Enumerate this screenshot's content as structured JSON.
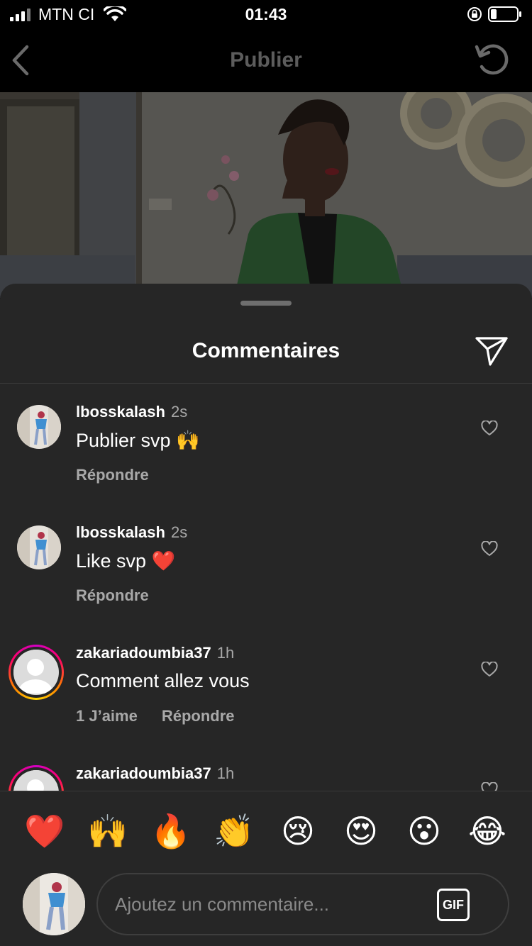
{
  "status_bar": {
    "carrier": "MTN CI",
    "time": "01:43"
  },
  "nav": {
    "title": "Publier"
  },
  "sheet": {
    "title": "Commentaires"
  },
  "comments": [
    {
      "username": "lbosskalash",
      "time": "2s",
      "text": "Publier svp 🙌",
      "likes": "",
      "reply": "Répondre",
      "has_story_ring": false
    },
    {
      "username": "lbosskalash",
      "time": "2s",
      "text": "Like svp ❤️",
      "likes": "",
      "reply": "Répondre",
      "has_story_ring": false
    },
    {
      "username": "zakariadoumbia37",
      "time": "1h",
      "text": "Comment allez vous",
      "likes": "1 J’aime",
      "reply": "Répondre",
      "has_story_ring": true
    },
    {
      "username": "zakariadoumbia37",
      "time": "1h",
      "text": "",
      "likes": "",
      "reply": "",
      "has_story_ring": true
    }
  ],
  "quick_reactions": [
    "❤️",
    "🙌",
    "🔥",
    "👏",
    "😢",
    "😍",
    "😮",
    "😂"
  ],
  "composer": {
    "placeholder": "Ajoutez un commentaire...",
    "gif_label": "GIF"
  },
  "colors": {
    "sheet_bg": "#262626",
    "secondary_text": "#a8a8a8",
    "nav_title": "#5c5c5c"
  }
}
